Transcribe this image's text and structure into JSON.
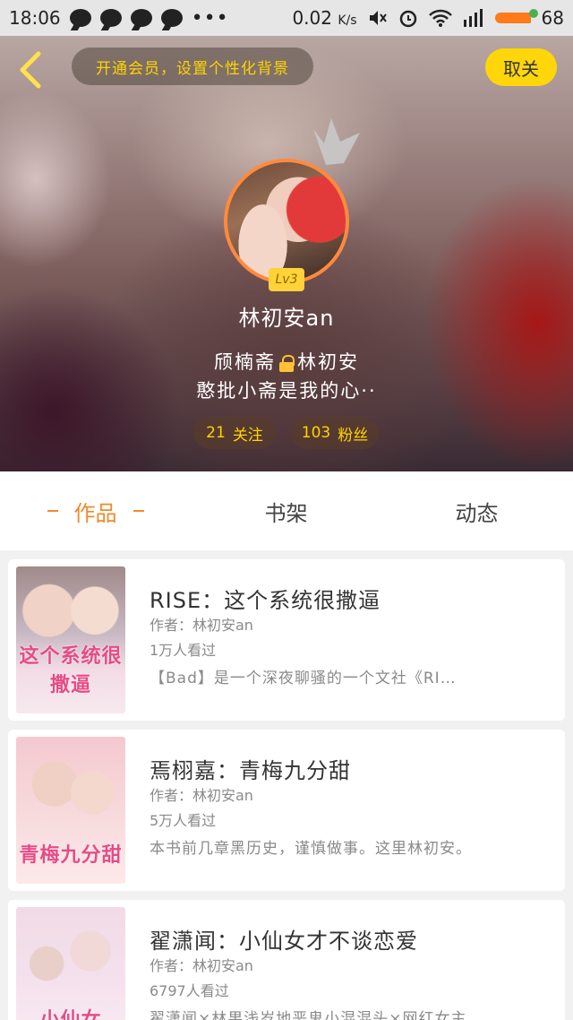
{
  "status_bar": {
    "time": "18:06",
    "speed_value": "0.02",
    "speed_unit": "K/s",
    "battery": "68"
  },
  "header": {
    "back_icon": "chevron-left-icon",
    "vip_text": "开通会员，设置个性化背景",
    "cancel_label": "取关",
    "level": "Lv3",
    "username": "林初安an",
    "bio_part1": "颀楠斋",
    "bio_part2": "林初安",
    "bio_line2": "憨批小斋是我的心··",
    "follow_count": "21",
    "follow_label": "关注",
    "fans_count": "103",
    "fans_label": "粉丝",
    "accent_color": "#ffd60a"
  },
  "tabs": {
    "works": "作品",
    "bookshelf": "书架",
    "activity": "动态",
    "active_color": "#f08a2c"
  },
  "works": [
    {
      "title": "RISE：这个系统很撒逼",
      "author": "作者：林初安an",
      "views": "1万人看过",
      "desc": "【Bad】是一个深夜聊骚的一个文社《RI…",
      "cover_text": "这个系统很撒逼"
    },
    {
      "title": "焉栩嘉：青梅九分甜",
      "author": "作者：林初安an",
      "views": "5万人看过",
      "desc": "本书前几章黑历史，谨慎做事。这里林初安。",
      "cover_text": "青梅九分甜"
    },
    {
      "title": "翟潇闻：小仙女才不谈恋爱",
      "author": "作者：林初安an",
      "views": "6797人看过",
      "desc": "翟潇闻×林果浅岁地恶鬼小混混头×网红女主",
      "cover_text": "小仙女"
    }
  ]
}
